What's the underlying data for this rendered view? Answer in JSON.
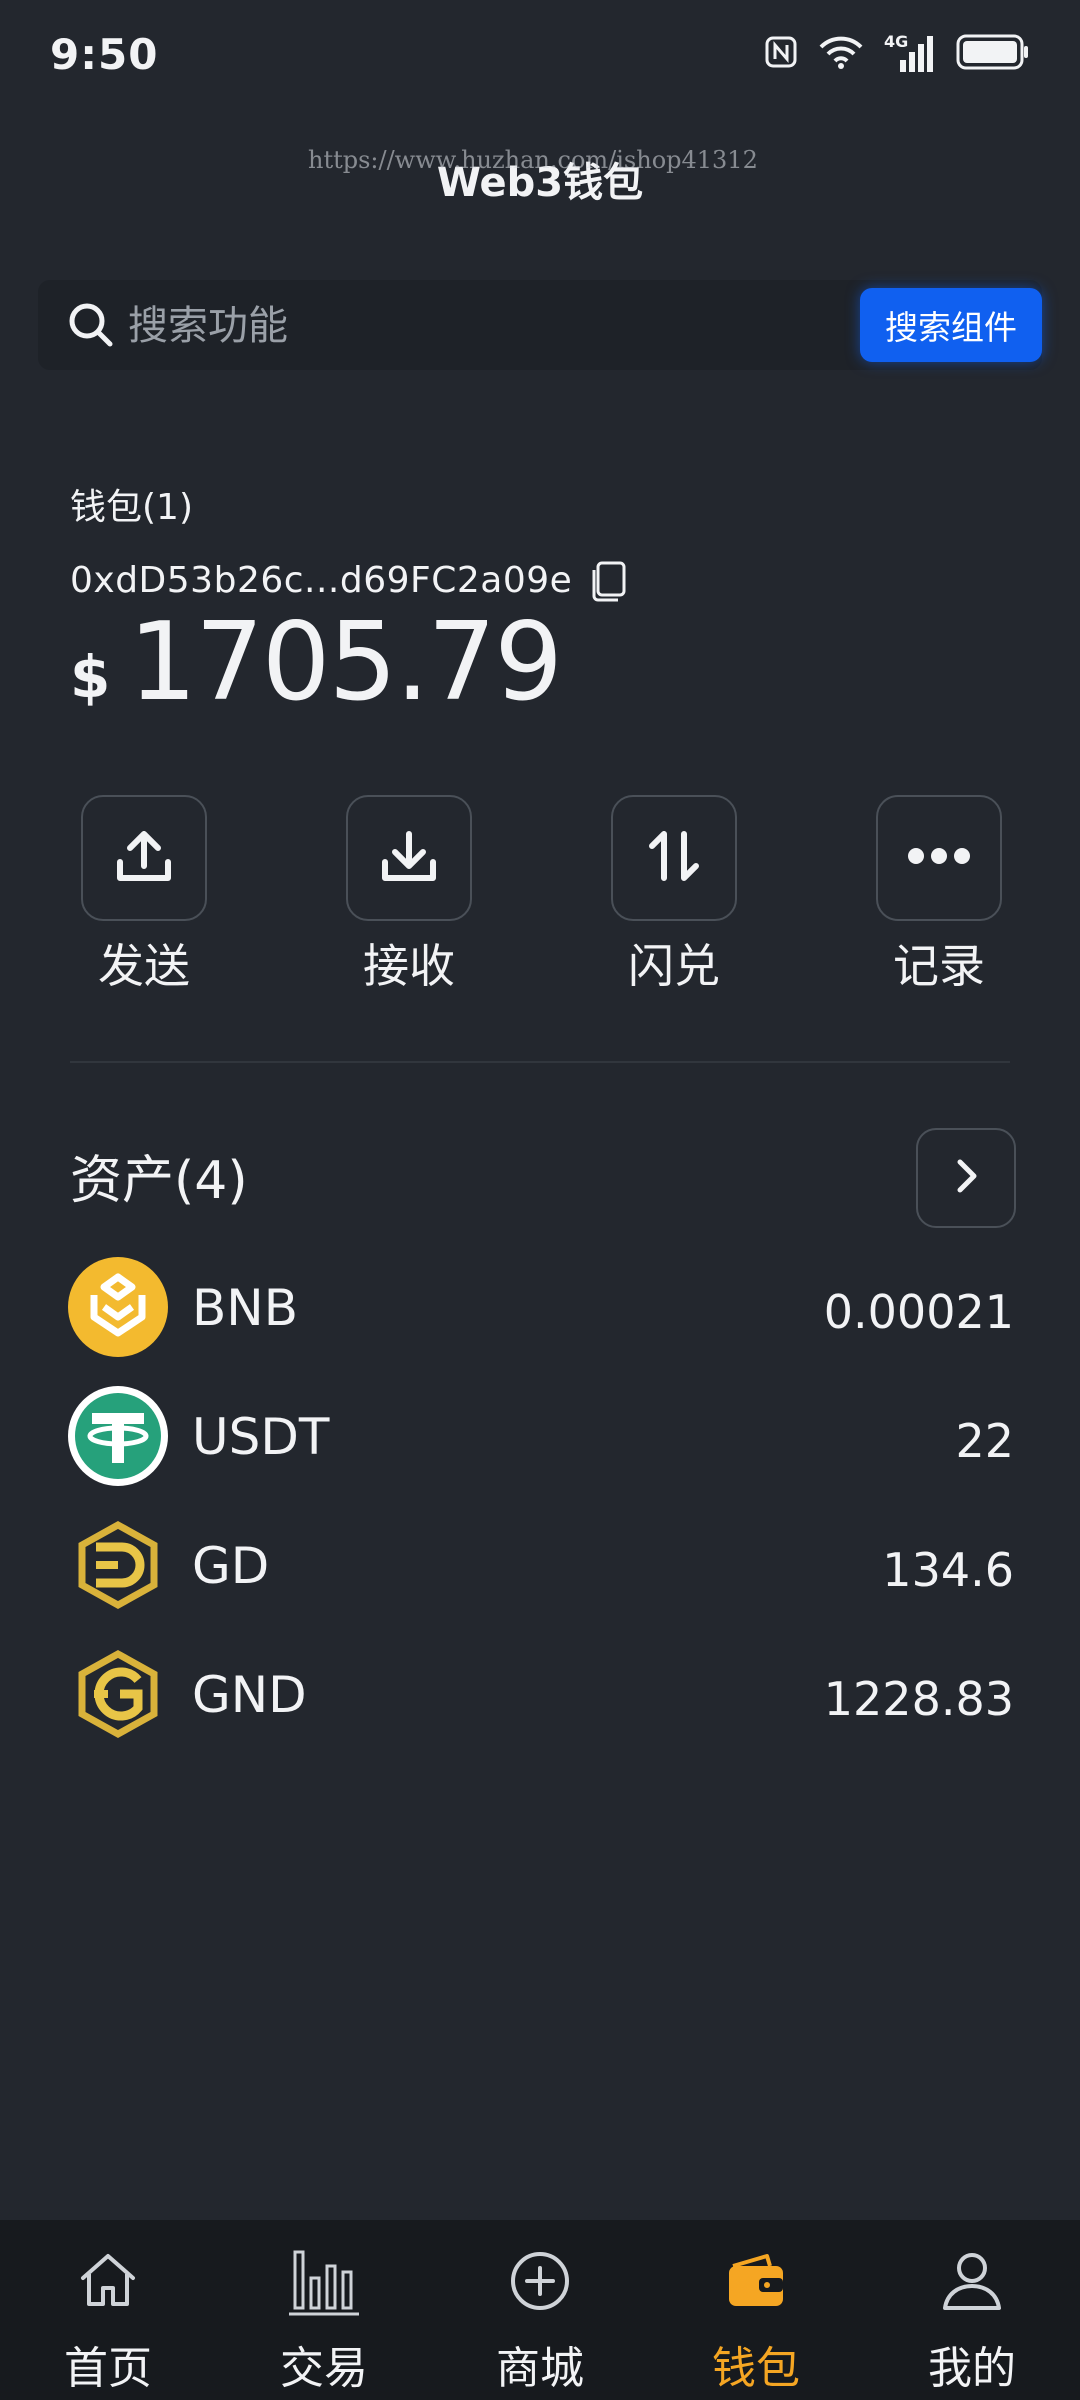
{
  "status_bar": {
    "time": "9:50",
    "network": "4G"
  },
  "header": {
    "title": "Web3钱包",
    "watermark": "https://www.huzhan.com/ishop41312"
  },
  "search": {
    "placeholder": "搜索功能",
    "button_label": "搜索组件"
  },
  "wallet": {
    "name": "钱包(1)",
    "address": "0xdD53b26c...d69FC2a09e",
    "currency_symbol": "$",
    "balance": "1705.79"
  },
  "actions": [
    {
      "label": "发送",
      "icon": "upload-icon"
    },
    {
      "label": "接收",
      "icon": "download-icon"
    },
    {
      "label": "闪兑",
      "icon": "swap-icon"
    },
    {
      "label": "记录",
      "icon": "more-icon"
    }
  ],
  "assets": {
    "title": "资产(4)",
    "items": [
      {
        "name": "BNB",
        "value": "0.00021",
        "icon": "bnb-coin-icon",
        "color": "#F3BA2F"
      },
      {
        "name": "USDT",
        "value": "22",
        "icon": "usdt-coin-icon",
        "color": "#26A17B"
      },
      {
        "name": "GD",
        "value": "134.6",
        "icon": "gd-coin-icon",
        "color": "#D9B23A"
      },
      {
        "name": "GND",
        "value": "1228.83",
        "icon": "gnd-coin-icon",
        "color": "#D9B23A"
      }
    ]
  },
  "tabbar": {
    "active_color": "#F5A623",
    "items": [
      {
        "label": "首页",
        "icon": "home-icon"
      },
      {
        "label": "交易",
        "icon": "bar-chart-icon"
      },
      {
        "label": "商城",
        "icon": "plus-circle-icon"
      },
      {
        "label": "钱包",
        "icon": "wallet-icon"
      },
      {
        "label": "我的",
        "icon": "user-icon"
      }
    ]
  }
}
